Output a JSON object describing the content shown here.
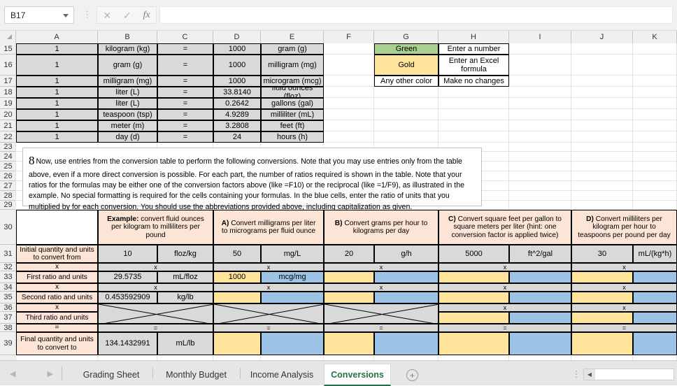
{
  "formula_bar": {
    "name_box_value": "B17",
    "formula_value": "",
    "cancel_icon": "close-icon",
    "confirm_icon": "check-icon",
    "function_icon": "fx"
  },
  "grid": {
    "columns": [
      "A",
      "B",
      "C",
      "D",
      "E",
      "F",
      "G",
      "H",
      "I",
      "J",
      "K"
    ],
    "rows": [
      "15",
      "16",
      "17",
      "18",
      "19",
      "20",
      "21",
      "22",
      "23",
      "24",
      "25",
      "26",
      "27",
      "28",
      "29",
      "30",
      "31",
      "32",
      "33",
      "34",
      "35",
      "36",
      "37",
      "38",
      "39"
    ]
  },
  "conversion_table": {
    "rows": [
      {
        "row": "15",
        "qty": "1",
        "from_unit": "kilogram (kg)",
        "eq": "=",
        "factor": "1000",
        "to_unit": "gram (g)"
      },
      {
        "row": "16",
        "qty": "1",
        "from_unit": "gram (g)",
        "eq": "=",
        "factor": "1000",
        "to_unit": "milligram (mg)"
      },
      {
        "row": "17",
        "qty": "1",
        "from_unit": "milligram (mg)",
        "eq": "=",
        "factor": "1000",
        "to_unit": "microgram (mcg)"
      },
      {
        "row": "18",
        "qty": "1",
        "from_unit": "liter (L)",
        "eq": "=",
        "factor": "33.8140",
        "to_unit": "fluid ounces (floz)"
      },
      {
        "row": "19",
        "qty": "1",
        "from_unit": "liter (L)",
        "eq": "=",
        "factor": "0.2642",
        "to_unit": "gallons (gal)"
      },
      {
        "row": "20",
        "qty": "1",
        "from_unit": "teaspoon (tsp)",
        "eq": "=",
        "factor": "4.9289",
        "to_unit": "milliliter (mL)"
      },
      {
        "row": "21",
        "qty": "1",
        "from_unit": "meter (m)",
        "eq": "=",
        "factor": "3.2808",
        "to_unit": "feet (ft)"
      },
      {
        "row": "22",
        "qty": "1",
        "from_unit": "day (d)",
        "eq": "=",
        "factor": "24",
        "to_unit": "hours (h)"
      }
    ]
  },
  "legend": {
    "rows": [
      {
        "color_name": "Green",
        "action": "Enter a number",
        "swatch": "#a9d08e"
      },
      {
        "color_name": "Gold",
        "action": "Enter an Excel formula",
        "swatch": "#ffe49b"
      },
      {
        "color_name": "Any other color",
        "action": "Make no changes",
        "swatch": "#ffffff"
      }
    ]
  },
  "instruction_note": {
    "number": "8",
    "text": "Now, use entries from the conversion table to perform the following conversions.  Note that you may use entries only from the table above, even if a more direct conversion is possible.  For each part, the number of ratios required is shown in the table.  Note that your ratios for the formulas may be either one of the conversion factors above (like =F10) or the reciprocal (like =1/F9), as illustrated in the example.  No special formatting is required for the cells containing your formulas.  In the blue cells, enter the ratio of units that you multiplied by for each conversion.  You should use the abbreviations provided above, including capitalization as given."
  },
  "exercise_table": {
    "row_labels": {
      "r31": "Initial quantity and units to convert from",
      "r32": "x",
      "r33": "First ratio and units",
      "r34": "x",
      "r35": "Second ratio and units",
      "r36": "x",
      "r37": "Third ratio and units",
      "r38": "=",
      "r39": "Final quantity and units to convert to"
    },
    "headers": [
      {
        "prefix": "Example:",
        "text": " convert fluid ounces per kilogram to milliliters per pound"
      },
      {
        "prefix": "A)",
        "text": " Convert milligrams per liter to micrograms per fluid ounce"
      },
      {
        "prefix": "B)",
        "text": " Convert grams per hour to kilograms per day"
      },
      {
        "prefix": "C)",
        "text": " Convert square feet per gallon to square meters per liter (hint: one conversion factor is applied twice)"
      },
      {
        "prefix": "D)",
        "text": " Convert milliliters per kilogram per hour to teaspoons per pound per day"
      }
    ],
    "columns": [
      {
        "id": "example",
        "initial_value": "10",
        "initial_units": "floz/kg",
        "first_value": "29.5735",
        "first_units": "mL/floz",
        "second_value": "0.453592909",
        "second_units": "kg/lb",
        "third_value": "",
        "third_units": "",
        "third_blocked": true,
        "final_value": "134.1432991",
        "final_units": "mL/lb",
        "value_fill": "grey",
        "units_fill": "grey",
        "final_value_fill": "grey",
        "final_units_fill": "grey"
      },
      {
        "id": "a",
        "initial_value": "50",
        "initial_units": "mg/L",
        "first_value": "1000",
        "first_units": "mcg/mg",
        "second_value": "",
        "second_units": "",
        "third_value": "",
        "third_units": "",
        "third_blocked": true,
        "final_value": "",
        "final_units": "",
        "value_fill": "grey",
        "units_fill": "grey",
        "final_value_fill": "gold",
        "final_units_fill": "blue"
      },
      {
        "id": "b",
        "initial_value": "20",
        "initial_units": "g/h",
        "first_value": "",
        "first_units": "",
        "second_value": "",
        "second_units": "",
        "third_value": "",
        "third_units": "",
        "third_blocked": true,
        "final_value": "",
        "final_units": "",
        "value_fill": "grey",
        "units_fill": "grey",
        "final_value_fill": "gold",
        "final_units_fill": "blue"
      },
      {
        "id": "c",
        "initial_value": "5000",
        "initial_units": "ft^2/gal",
        "first_value": "",
        "first_units": "",
        "second_value": "",
        "second_units": "",
        "third_value": "",
        "third_units": "",
        "third_blocked": false,
        "final_value": "",
        "final_units": "",
        "value_fill": "grey",
        "units_fill": "grey",
        "final_value_fill": "gold",
        "final_units_fill": "blue"
      },
      {
        "id": "d",
        "initial_value": "30",
        "initial_units": "mL/(kg*h)",
        "first_value": "",
        "first_units": "",
        "second_value": "",
        "second_units": "",
        "third_value": "",
        "third_units": "",
        "third_blocked": false,
        "final_value": "",
        "final_units": "",
        "value_fill": "grey",
        "units_fill": "grey",
        "final_value_fill": "gold",
        "final_units_fill": "blue"
      }
    ],
    "operator_x": "x",
    "operator_eq": "="
  },
  "sheet_tabs": {
    "tabs": [
      {
        "label": "Grading Sheet",
        "active": false
      },
      {
        "label": "Monthly Budget",
        "active": false
      },
      {
        "label": "Income Analysis",
        "active": false
      },
      {
        "label": "Conversions",
        "active": true
      }
    ],
    "add_sheet_label": "+",
    "prev_arrow": "◀",
    "next_arrow": "▶",
    "scroll_left_arrow": "◀"
  },
  "colors": {
    "accent_green": "#217346",
    "grey_fill": "#d9d9d9",
    "gold_fill": "#ffe49b",
    "blue_fill": "#9dc3e6",
    "peach_fill": "#fce4d6",
    "green_fill": "#a9d08e"
  }
}
